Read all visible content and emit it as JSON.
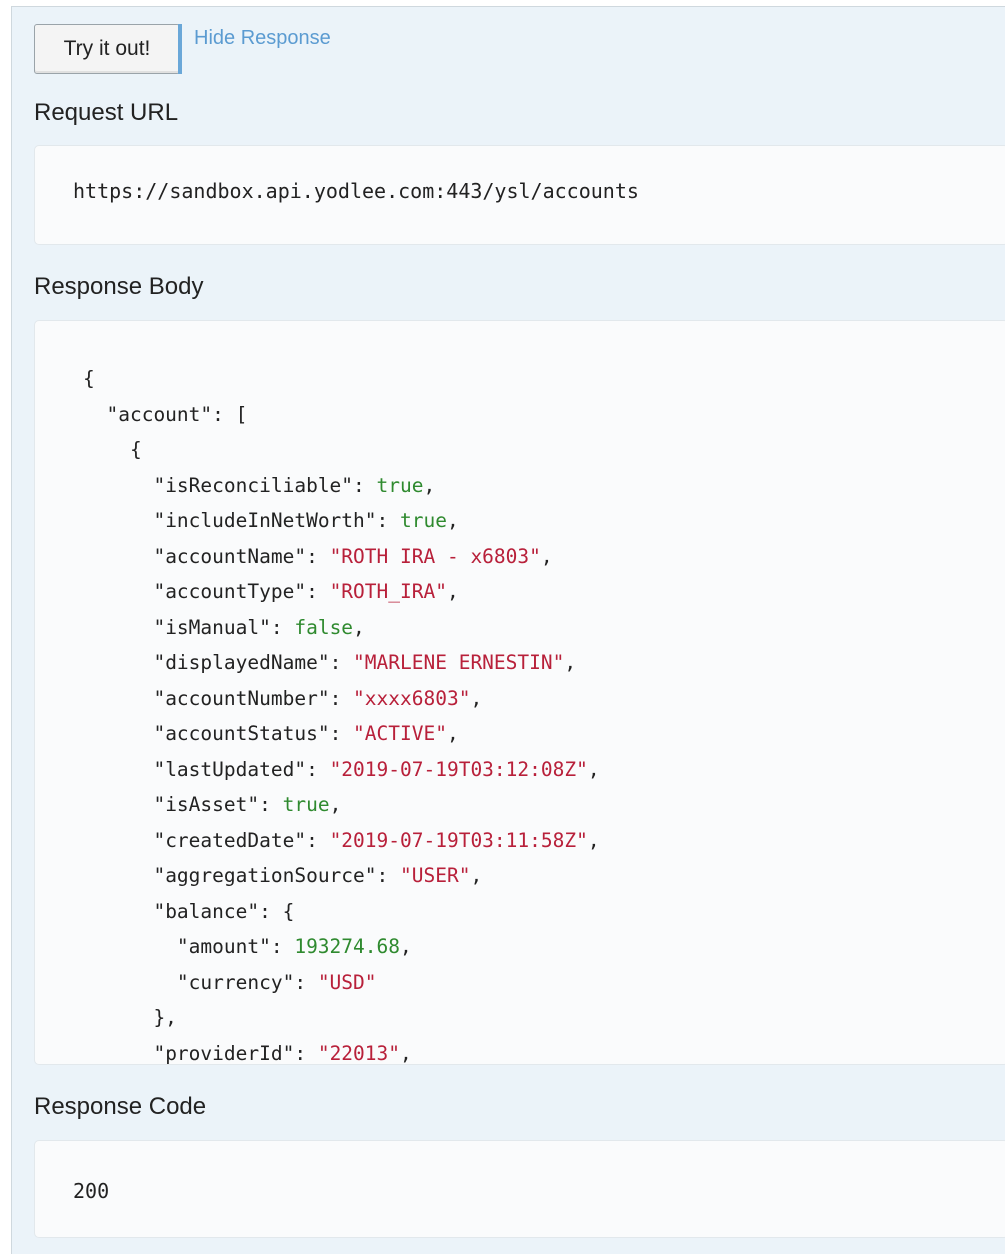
{
  "controls": {
    "try_button_label": "Try it out!",
    "hide_response_label": "Hide Response"
  },
  "request_url": {
    "title": "Request URL",
    "value": "https://sandbox.api.yodlee.com:443/ysl/accounts"
  },
  "response_body": {
    "title": "Response Body",
    "lines": [
      [
        {
          "t": "p",
          "v": "{"
        }
      ],
      [
        {
          "t": "p",
          "v": "  "
        },
        {
          "t": "k",
          "v": "\"account\""
        },
        {
          "t": "p",
          "v": ": ["
        }
      ],
      [
        {
          "t": "p",
          "v": "    {"
        }
      ],
      [
        {
          "t": "p",
          "v": "      "
        },
        {
          "t": "k",
          "v": "\"isReconciliable\""
        },
        {
          "t": "p",
          "v": ": "
        },
        {
          "t": "l",
          "v": "true"
        },
        {
          "t": "p",
          "v": ","
        }
      ],
      [
        {
          "t": "p",
          "v": "      "
        },
        {
          "t": "k",
          "v": "\"includeInNetWorth\""
        },
        {
          "t": "p",
          "v": ": "
        },
        {
          "t": "l",
          "v": "true"
        },
        {
          "t": "p",
          "v": ","
        }
      ],
      [
        {
          "t": "p",
          "v": "      "
        },
        {
          "t": "k",
          "v": "\"accountName\""
        },
        {
          "t": "p",
          "v": ": "
        },
        {
          "t": "s",
          "v": "\"ROTH IRA - x6803\""
        },
        {
          "t": "p",
          "v": ","
        }
      ],
      [
        {
          "t": "p",
          "v": "      "
        },
        {
          "t": "k",
          "v": "\"accountType\""
        },
        {
          "t": "p",
          "v": ": "
        },
        {
          "t": "s",
          "v": "\"ROTH_IRA\""
        },
        {
          "t": "p",
          "v": ","
        }
      ],
      [
        {
          "t": "p",
          "v": "      "
        },
        {
          "t": "k",
          "v": "\"isManual\""
        },
        {
          "t": "p",
          "v": ": "
        },
        {
          "t": "l",
          "v": "false"
        },
        {
          "t": "p",
          "v": ","
        }
      ],
      [
        {
          "t": "p",
          "v": "      "
        },
        {
          "t": "k",
          "v": "\"displayedName\""
        },
        {
          "t": "p",
          "v": ": "
        },
        {
          "t": "s",
          "v": "\"MARLENE ERNESTIN\""
        },
        {
          "t": "p",
          "v": ","
        }
      ],
      [
        {
          "t": "p",
          "v": "      "
        },
        {
          "t": "k",
          "v": "\"accountNumber\""
        },
        {
          "t": "p",
          "v": ": "
        },
        {
          "t": "s",
          "v": "\"xxxx6803\""
        },
        {
          "t": "p",
          "v": ","
        }
      ],
      [
        {
          "t": "p",
          "v": "      "
        },
        {
          "t": "k",
          "v": "\"accountStatus\""
        },
        {
          "t": "p",
          "v": ": "
        },
        {
          "t": "s",
          "v": "\"ACTIVE\""
        },
        {
          "t": "p",
          "v": ","
        }
      ],
      [
        {
          "t": "p",
          "v": "      "
        },
        {
          "t": "k",
          "v": "\"lastUpdated\""
        },
        {
          "t": "p",
          "v": ": "
        },
        {
          "t": "s",
          "v": "\"2019-07-19T03:12:08Z\""
        },
        {
          "t": "p",
          "v": ","
        }
      ],
      [
        {
          "t": "p",
          "v": "      "
        },
        {
          "t": "k",
          "v": "\"isAsset\""
        },
        {
          "t": "p",
          "v": ": "
        },
        {
          "t": "l",
          "v": "true"
        },
        {
          "t": "p",
          "v": ","
        }
      ],
      [
        {
          "t": "p",
          "v": "      "
        },
        {
          "t": "k",
          "v": "\"createdDate\""
        },
        {
          "t": "p",
          "v": ": "
        },
        {
          "t": "s",
          "v": "\"2019-07-19T03:11:58Z\""
        },
        {
          "t": "p",
          "v": ","
        }
      ],
      [
        {
          "t": "p",
          "v": "      "
        },
        {
          "t": "k",
          "v": "\"aggregationSource\""
        },
        {
          "t": "p",
          "v": ": "
        },
        {
          "t": "s",
          "v": "\"USER\""
        },
        {
          "t": "p",
          "v": ","
        }
      ],
      [
        {
          "t": "p",
          "v": "      "
        },
        {
          "t": "k",
          "v": "\"balance\""
        },
        {
          "t": "p",
          "v": ": {"
        }
      ],
      [
        {
          "t": "p",
          "v": "        "
        },
        {
          "t": "k",
          "v": "\"amount\""
        },
        {
          "t": "p",
          "v": ": "
        },
        {
          "t": "n",
          "v": "193274.68"
        },
        {
          "t": "p",
          "v": ","
        }
      ],
      [
        {
          "t": "p",
          "v": "        "
        },
        {
          "t": "k",
          "v": "\"currency\""
        },
        {
          "t": "p",
          "v": ": "
        },
        {
          "t": "s",
          "v": "\"USD\""
        }
      ],
      [
        {
          "t": "p",
          "v": "      },"
        }
      ],
      [
        {
          "t": "p",
          "v": "      "
        },
        {
          "t": "k",
          "v": "\"providerId\""
        },
        {
          "t": "p",
          "v": ": "
        },
        {
          "t": "s",
          "v": "\"22013\""
        },
        {
          "t": "p",
          "v": ","
        }
      ]
    ]
  },
  "response_code": {
    "title": "Response Code",
    "value": "200"
  },
  "colors": {
    "background": "#ebf3f9",
    "link": "#5b9bd1",
    "string": "#b8203a",
    "literal": "#2f8a2f"
  }
}
